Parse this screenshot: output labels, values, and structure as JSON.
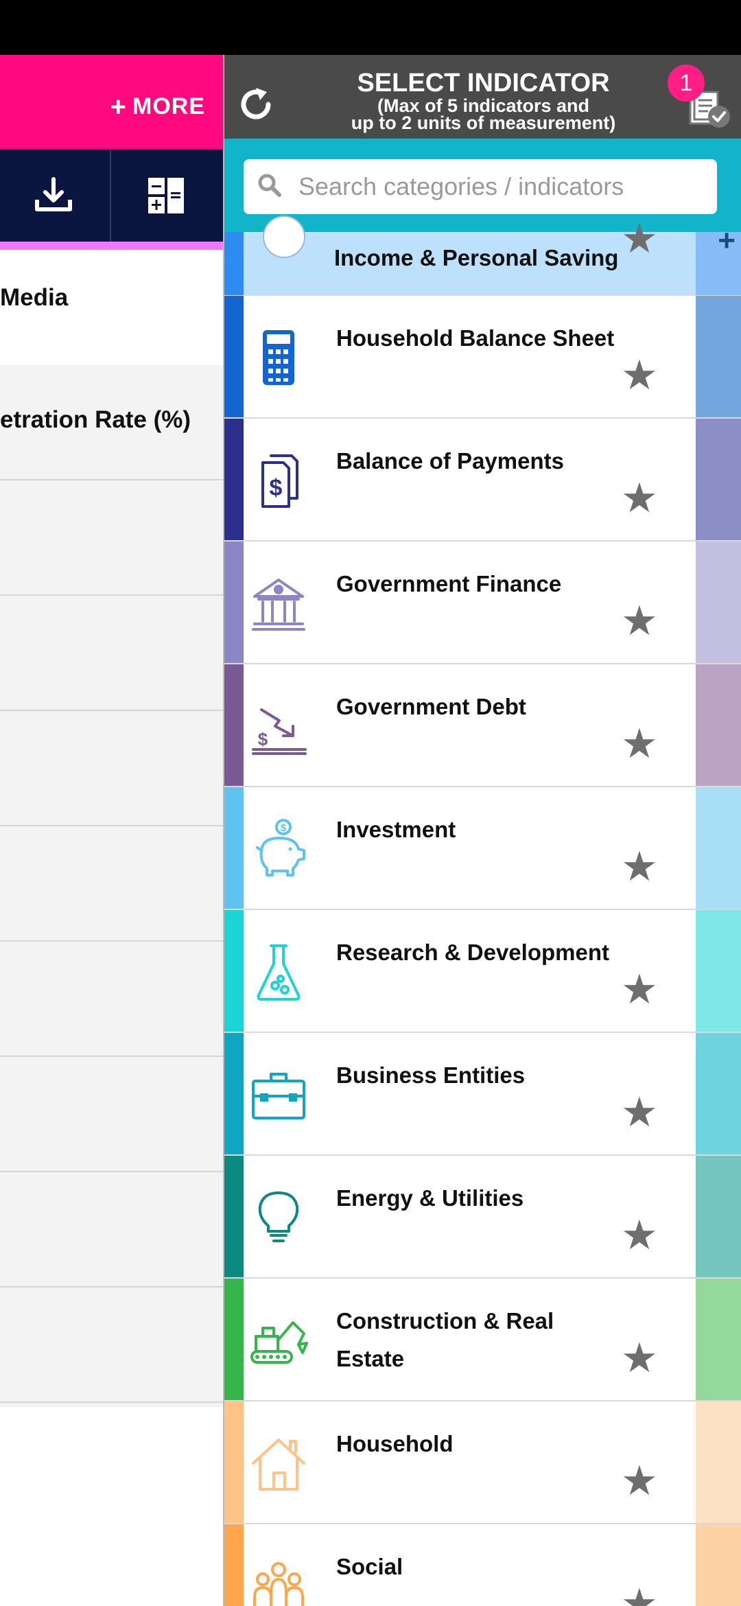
{
  "left_panel": {
    "more_label": "MORE",
    "rows": [
      {
        "label": "Media"
      },
      {
        "label": "etration Rate (%)"
      },
      {
        "label": ""
      },
      {
        "label": ""
      },
      {
        "label": ""
      },
      {
        "label": ""
      },
      {
        "label": ""
      },
      {
        "label": ""
      },
      {
        "label": ""
      },
      {
        "label": ""
      }
    ]
  },
  "drawer": {
    "title": "SELECT INDICATOR",
    "subtitle_line1": "(Max of 5 indicators and",
    "subtitle_line2": "up to 2 units of measurement)",
    "selected_count": "1",
    "search": {
      "placeholder": "Search categories / indicators",
      "value": ""
    },
    "categories": [
      {
        "label": "Income & Personal Saving",
        "color": "#2e8bf0",
        "side_color": "#86bdf6",
        "icon": "wallet-icon"
      },
      {
        "label": "Household Balance Sheet",
        "color": "#1565d0",
        "side_color": "#72a6dc",
        "icon": "calculator-icon"
      },
      {
        "label": "Balance of Payments",
        "color": "#2c2f8e",
        "side_color": "#8b8fc6",
        "icon": "dollar-documents-icon"
      },
      {
        "label": "Government Finance",
        "color": "#8b86c6",
        "side_color": "#c3c0e2",
        "icon": "bank-icon"
      },
      {
        "label": "Government Debt",
        "color": "#7a5a92",
        "side_color": "#b9a4c4",
        "icon": "debt-down-icon"
      },
      {
        "label": "Investment",
        "color": "#5ec3f0",
        "side_color": "#a9dff6",
        "icon": "piggy-bank-icon"
      },
      {
        "label": "Research & Development",
        "color": "#1ed3d3",
        "side_color": "#7ee8e6",
        "icon": "flask-icon"
      },
      {
        "label": "Business Entities",
        "color": "#10a5c3",
        "side_color": "#6fd2df",
        "icon": "toolbox-icon"
      },
      {
        "label": "Energy & Utilities",
        "color": "#0d8a80",
        "side_color": "#73c5bd",
        "icon": "lightbulb-icon"
      },
      {
        "label": "Construction & Real Estate",
        "color": "#36b54a",
        "side_color": "#94d89c",
        "icon": "excavator-icon"
      },
      {
        "label": "Household",
        "color": "#ffc387",
        "side_color": "#fde1c3",
        "icon": "house-icon"
      },
      {
        "label": "Social",
        "color": "#ffa64d",
        "side_color": "#fcd3a4",
        "icon": "family-icon"
      }
    ]
  }
}
